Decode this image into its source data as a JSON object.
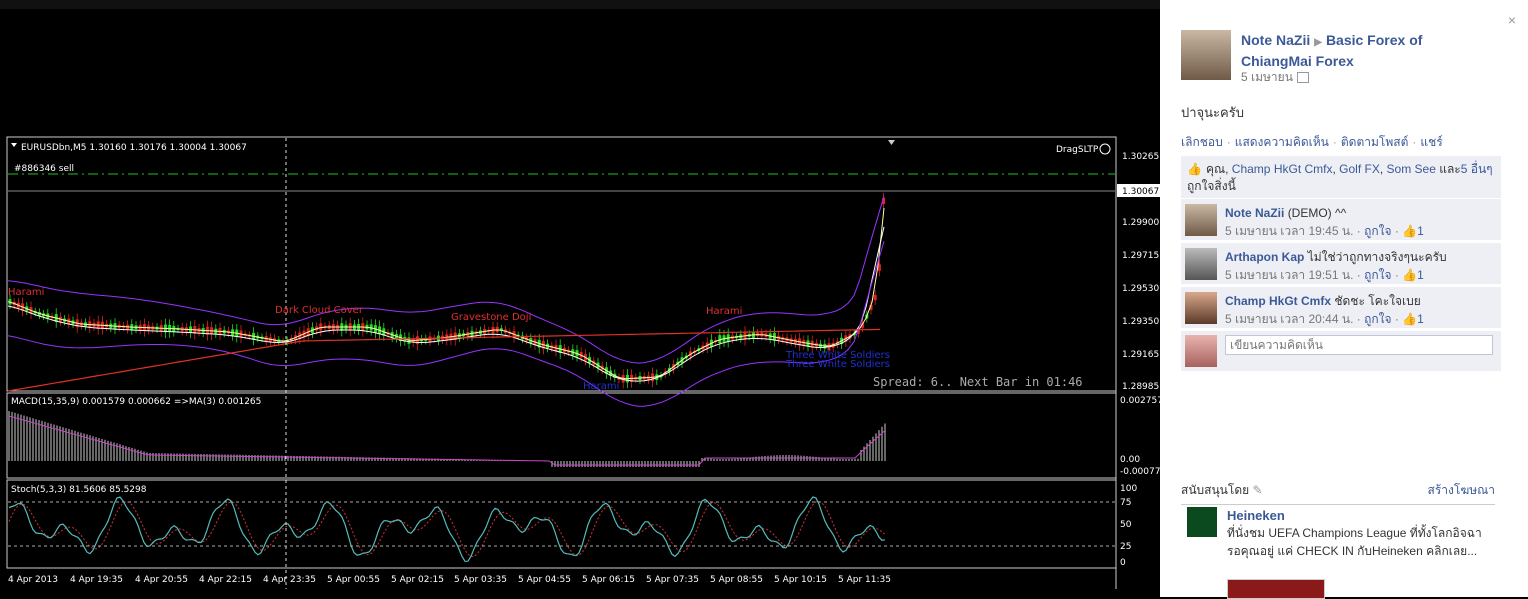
{
  "chart": {
    "symbol_info": "EURUSDbn,M5  1.30160 1.30176 1.30004 1.30067",
    "order_label": "#886346 sell",
    "drag_label": "DragSLTP",
    "spread_text": "Spread: 6.. Next Bar in 01:46",
    "price_ticks": [
      "1.30265",
      "1.30067",
      "1.29900",
      "1.29715",
      "1.29530",
      "1.29350",
      "1.29165",
      "1.28985"
    ],
    "macd_info": "MACD(15,35,9) 0.001579 0.000662  =>MA(3) 0.001265",
    "macd_ticks": [
      "0.002757",
      "0.00",
      "-0.000778"
    ],
    "stoch_info": "Stoch(5,3,3) 81.5606 85.5298",
    "stoch_ticks": [
      "100",
      "75",
      "50",
      "25",
      "0"
    ],
    "time_ticks": [
      "4 Apr 2013",
      "4 Apr 19:35",
      "4 Apr 20:55",
      "4 Apr 22:15",
      "4 Apr 23:35",
      "5 Apr 00:55",
      "5 Apr 02:15",
      "5 Apr 03:35",
      "5 Apr 04:55",
      "5 Apr 06:15",
      "5 Apr 07:35",
      "5 Apr 08:55",
      "5 Apr 10:15",
      "5 Apr 11:35"
    ],
    "patterns": [
      {
        "text": "Harami",
        "color": "#e03030"
      },
      {
        "text": "Dark Cloud Cover",
        "color": "#e03030"
      },
      {
        "text": "Gravestone Doji",
        "color": "#e03030"
      },
      {
        "text": "Harami",
        "color": "#e03030"
      },
      {
        "text": "Harami",
        "color": "#2030d0"
      },
      {
        "text": "Three White Soldiers",
        "color": "#2030d0"
      },
      {
        "text": "Three White Soldiers",
        "color": "#2030d0"
      }
    ]
  },
  "post": {
    "author": "Note NaZii",
    "target": "Basic Forex of ChiangMai Forex",
    "date": "5 เมษายน",
    "text": "ปาจุนะครับ",
    "actions": [
      "เลิกชอบ",
      "แสดงความคิดเห็น",
      "ติดตามโพสต์",
      "แชร์"
    ],
    "likes": {
      "prefix": "คุณ,",
      "names": [
        "Champ HkGt Cmfx",
        "Golf FX",
        "Som See"
      ],
      "joiner": "และ",
      "more": "5 อื่นๆ",
      "suffix": "ถูกใจสิ่งนี้"
    },
    "comments": [
      {
        "name": "Note NaZii",
        "text": "(DEMO) ^^",
        "time": "5 เมษายน เวลา 19:45 น.",
        "like_label": "ถูกใจ",
        "like_count": "1"
      },
      {
        "name": "Arthapon Kap",
        "text": "ไม่ใช่ว่าถูกทางจริงๆนะครับ",
        "time": "5 เมษายน เวลา 19:51 น.",
        "like_label": "ถูกใจ",
        "like_count": "1"
      },
      {
        "name": "Champ HkGt Cmfx",
        "text": "ชัดชะ โคะใจเบย",
        "time": "5 เมษายน เวลา 20:44 น.",
        "like_label": "ถูกใจ",
        "like_count": "1"
      }
    ],
    "comment_placeholder": "เขียนความคิดเห็น"
  },
  "sponsor": {
    "title": "สนับสนุนโดย",
    "create_label": "สร้างโฆษณา",
    "ad_name": "Heineken",
    "ad_text": "ที่นั่งชม UEFA Champions League ที่ทั้งโลกอิจฉา รอคุณอยู่ แค่ CHECK IN กับHeineken คลิกเลย..."
  },
  "close_label": "×"
}
